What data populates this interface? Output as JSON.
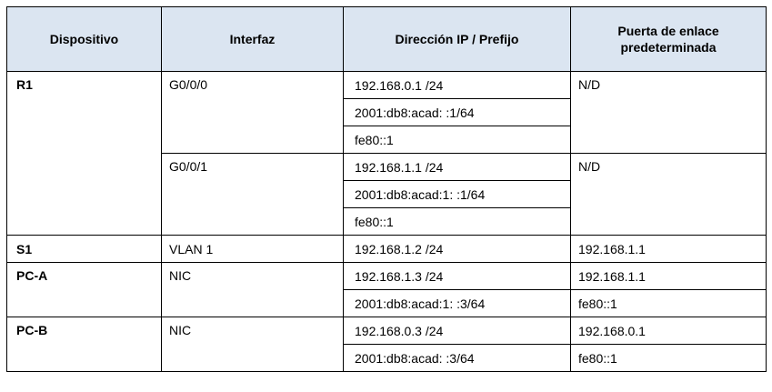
{
  "headers": {
    "device": "Dispositivo",
    "interface": "Interfaz",
    "ip_prefix": "Dirección IP / Prefijo",
    "gateway_line1": "Puerta de enlace",
    "gateway_line2": "predeterminada"
  },
  "rows": {
    "r1": {
      "device": "R1",
      "g000": {
        "interface": "G0/0/0",
        "ipv4": "192.168.0.1 /24",
        "ipv6": "2001:db8:acad: :1/64",
        "link_local": "fe80::1",
        "gateway": "N/D"
      },
      "g001": {
        "interface": "G0/0/1",
        "ipv4": "192.168.1.1 /24",
        "ipv6": "2001:db8:acad:1: :1/64",
        "link_local": "fe80::1",
        "gateway": "N/D"
      }
    },
    "s1": {
      "device": "S1",
      "interface": "VLAN 1",
      "ipv4": "192.168.1.2 /24",
      "gateway": "192.168.1.1"
    },
    "pca": {
      "device": "PC-A",
      "interface": "NIC",
      "ipv4": "192.168.1.3 /24",
      "gateway_v4": "192.168.1.1",
      "ipv6": "2001:db8:acad:1: :3/64",
      "gateway_v6": "fe80::1"
    },
    "pcb": {
      "device": "PC-B",
      "interface": "NIC",
      "ipv4": "192.168.0.3 /24",
      "gateway_v4": "192.168.0.1",
      "ipv6": "2001:db8:acad: :3/64",
      "gateway_v6": "fe80::1"
    }
  }
}
